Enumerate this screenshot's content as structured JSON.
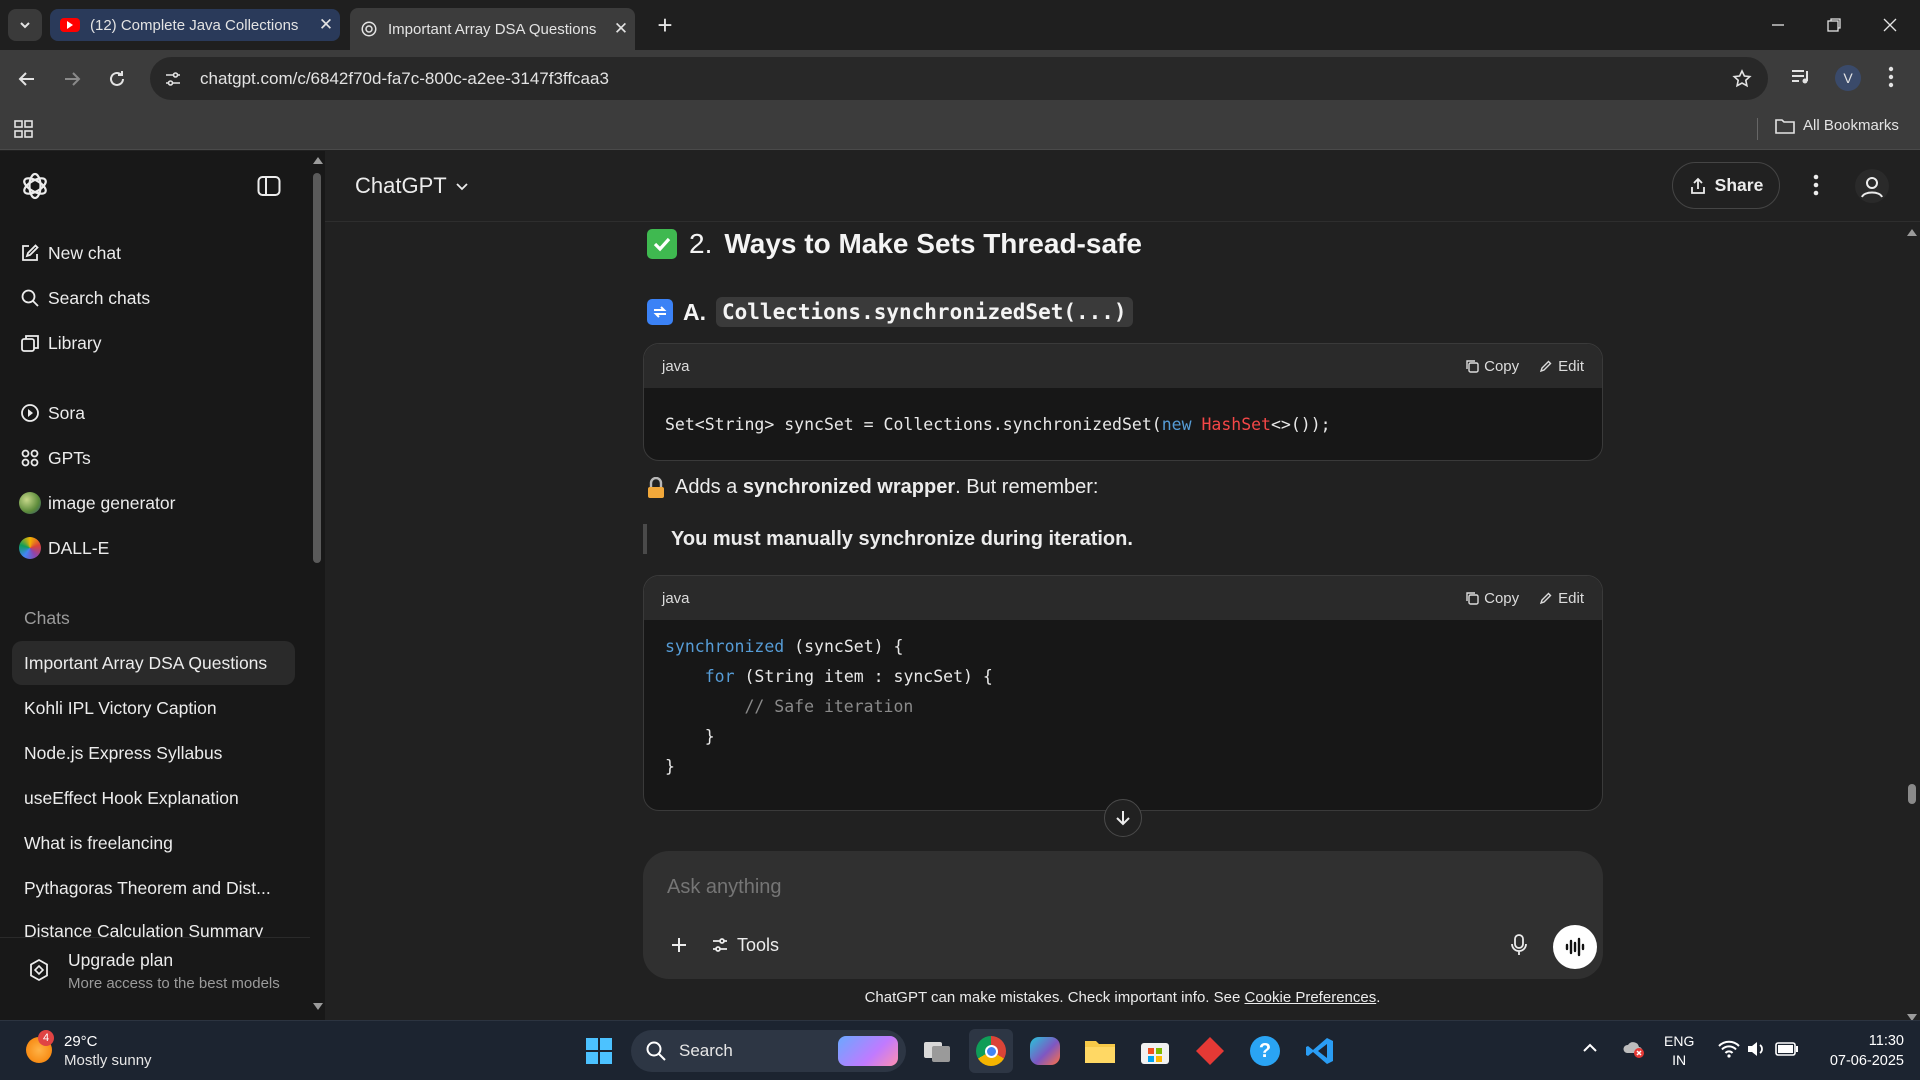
{
  "browser": {
    "tabs": [
      {
        "title": "(12) Complete Java Collections",
        "icon": "youtube-icon",
        "active": false
      },
      {
        "title": "Important Array DSA Questions",
        "icon": "openai-icon",
        "active": true
      }
    ],
    "url": "chatgpt.com/c/6842f70d-fa7c-800c-a2ee-3147f3ffcaa3",
    "profile_initial": "V",
    "bookmarks_label": "All Bookmarks"
  },
  "sidebar": {
    "top_items": [
      {
        "label": "New chat",
        "icon": "new-chat-icon"
      },
      {
        "label": "Search chats",
        "icon": "search-icon"
      },
      {
        "label": "Library",
        "icon": "library-icon"
      }
    ],
    "gpt_items": [
      {
        "label": "Sora",
        "icon": "sora-icon"
      },
      {
        "label": "GPTs",
        "icon": "gpts-icon"
      },
      {
        "label": "image generator",
        "icon": "image-generator-icon"
      },
      {
        "label": "DALL-E",
        "icon": "dalle-icon"
      }
    ],
    "chats_heading": "Chats",
    "chats": [
      "Important Array DSA Questions",
      "Kohli IPL Victory Caption",
      "Node.js Express Syllabus",
      "useEffect Hook Explanation",
      "What is freelancing",
      "Pythagoras Theorem and Dist...",
      "Distance Calculation Summary"
    ],
    "upgrade": {
      "title": "Upgrade plan",
      "subtitle": "More access to the best models"
    }
  },
  "header": {
    "model": "ChatGPT",
    "share": "Share"
  },
  "content": {
    "heading_number": "2.",
    "heading_text": "Ways to Make Sets Thread-safe",
    "sub_prefix": "A.",
    "sub_code": "Collections.synchronizedSet(...)",
    "code1": {
      "lang": "java",
      "copy": "Copy",
      "edit": "Edit",
      "tokens": [
        {
          "t": "Set<String> syncSet = Collections.synchronizedSet(",
          "c": ""
        },
        {
          "t": "new",
          "c": "kw"
        },
        {
          "t": " ",
          "c": ""
        },
        {
          "t": "HashSet",
          "c": "ty"
        },
        {
          "t": "<>());",
          "c": ""
        }
      ]
    },
    "note_prefix": "Adds a ",
    "note_bold": "synchronized wrapper",
    "note_suffix": ". But remember:",
    "quote": "You must manually synchronize during iteration.",
    "code2": {
      "lang": "java",
      "copy": "Copy",
      "edit": "Edit",
      "lines": [
        [
          {
            "t": "synchronized",
            "c": "kw"
          },
          {
            "t": " (syncSet) {",
            "c": ""
          }
        ],
        [
          {
            "t": "    ",
            "c": ""
          },
          {
            "t": "for",
            "c": "kw"
          },
          {
            "t": " (String item : syncSet) {",
            "c": ""
          }
        ],
        [
          {
            "t": "        // Safe iteration",
            "c": "cm"
          }
        ],
        [
          {
            "t": "    }",
            "c": ""
          }
        ],
        [
          {
            "t": "}",
            "c": ""
          }
        ]
      ]
    }
  },
  "composer": {
    "placeholder": "Ask anything",
    "tools": "Tools",
    "disclaimer_text": "ChatGPT can make mistakes. Check important info. See ",
    "disclaimer_link": "Cookie Preferences",
    "disclaimer_end": "."
  },
  "taskbar": {
    "weather_temp": "29°C",
    "weather_desc": "Mostly sunny",
    "weather_badge": "4",
    "search": "Search",
    "lang_top": "ENG",
    "lang_bottom": "IN",
    "time": "11:30",
    "date": "07-06-2025"
  },
  "colors": {
    "accent_green": "#3fb950",
    "code_keyword": "#569cd6",
    "code_type": "#f44747",
    "link": "#ffffff"
  }
}
